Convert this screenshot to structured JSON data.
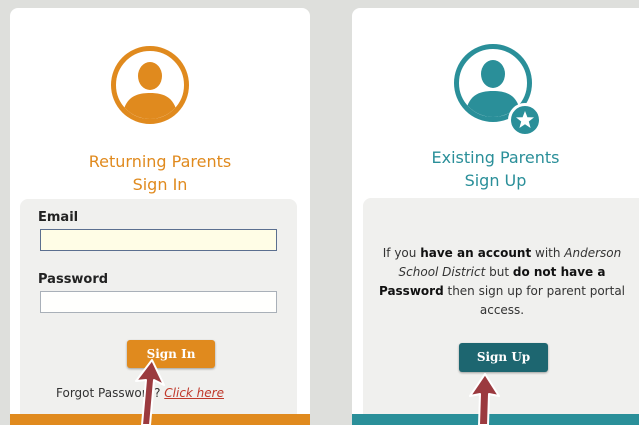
{
  "colors": {
    "orange": "#e08a1e",
    "teal": "#2a8f99",
    "teal_dark": "#1d6670",
    "arrow": "#9b3a3f"
  },
  "returning": {
    "title_line1": "Returning Parents",
    "title_line2": "Sign In",
    "icon": "user-avatar-icon",
    "email_label": "Email",
    "email_value": "",
    "password_label": "Password",
    "password_value": "",
    "sign_in_label": "Sign In",
    "forgot_text": "Forgot Password?",
    "click_here": "Click here"
  },
  "existing": {
    "title_line1": "Existing Parents",
    "title_line2": "Sign Up",
    "icon": "user-avatar-star-icon",
    "info_part1": "If you ",
    "info_bold1": "have an account",
    "info_part2": " with ",
    "info_italic": "Anderson School District",
    "info_part3": " but ",
    "info_bold2": "do not have a Password",
    "info_part4": " then sign up for parent portal access.",
    "sign_up_label": "Sign Up"
  }
}
